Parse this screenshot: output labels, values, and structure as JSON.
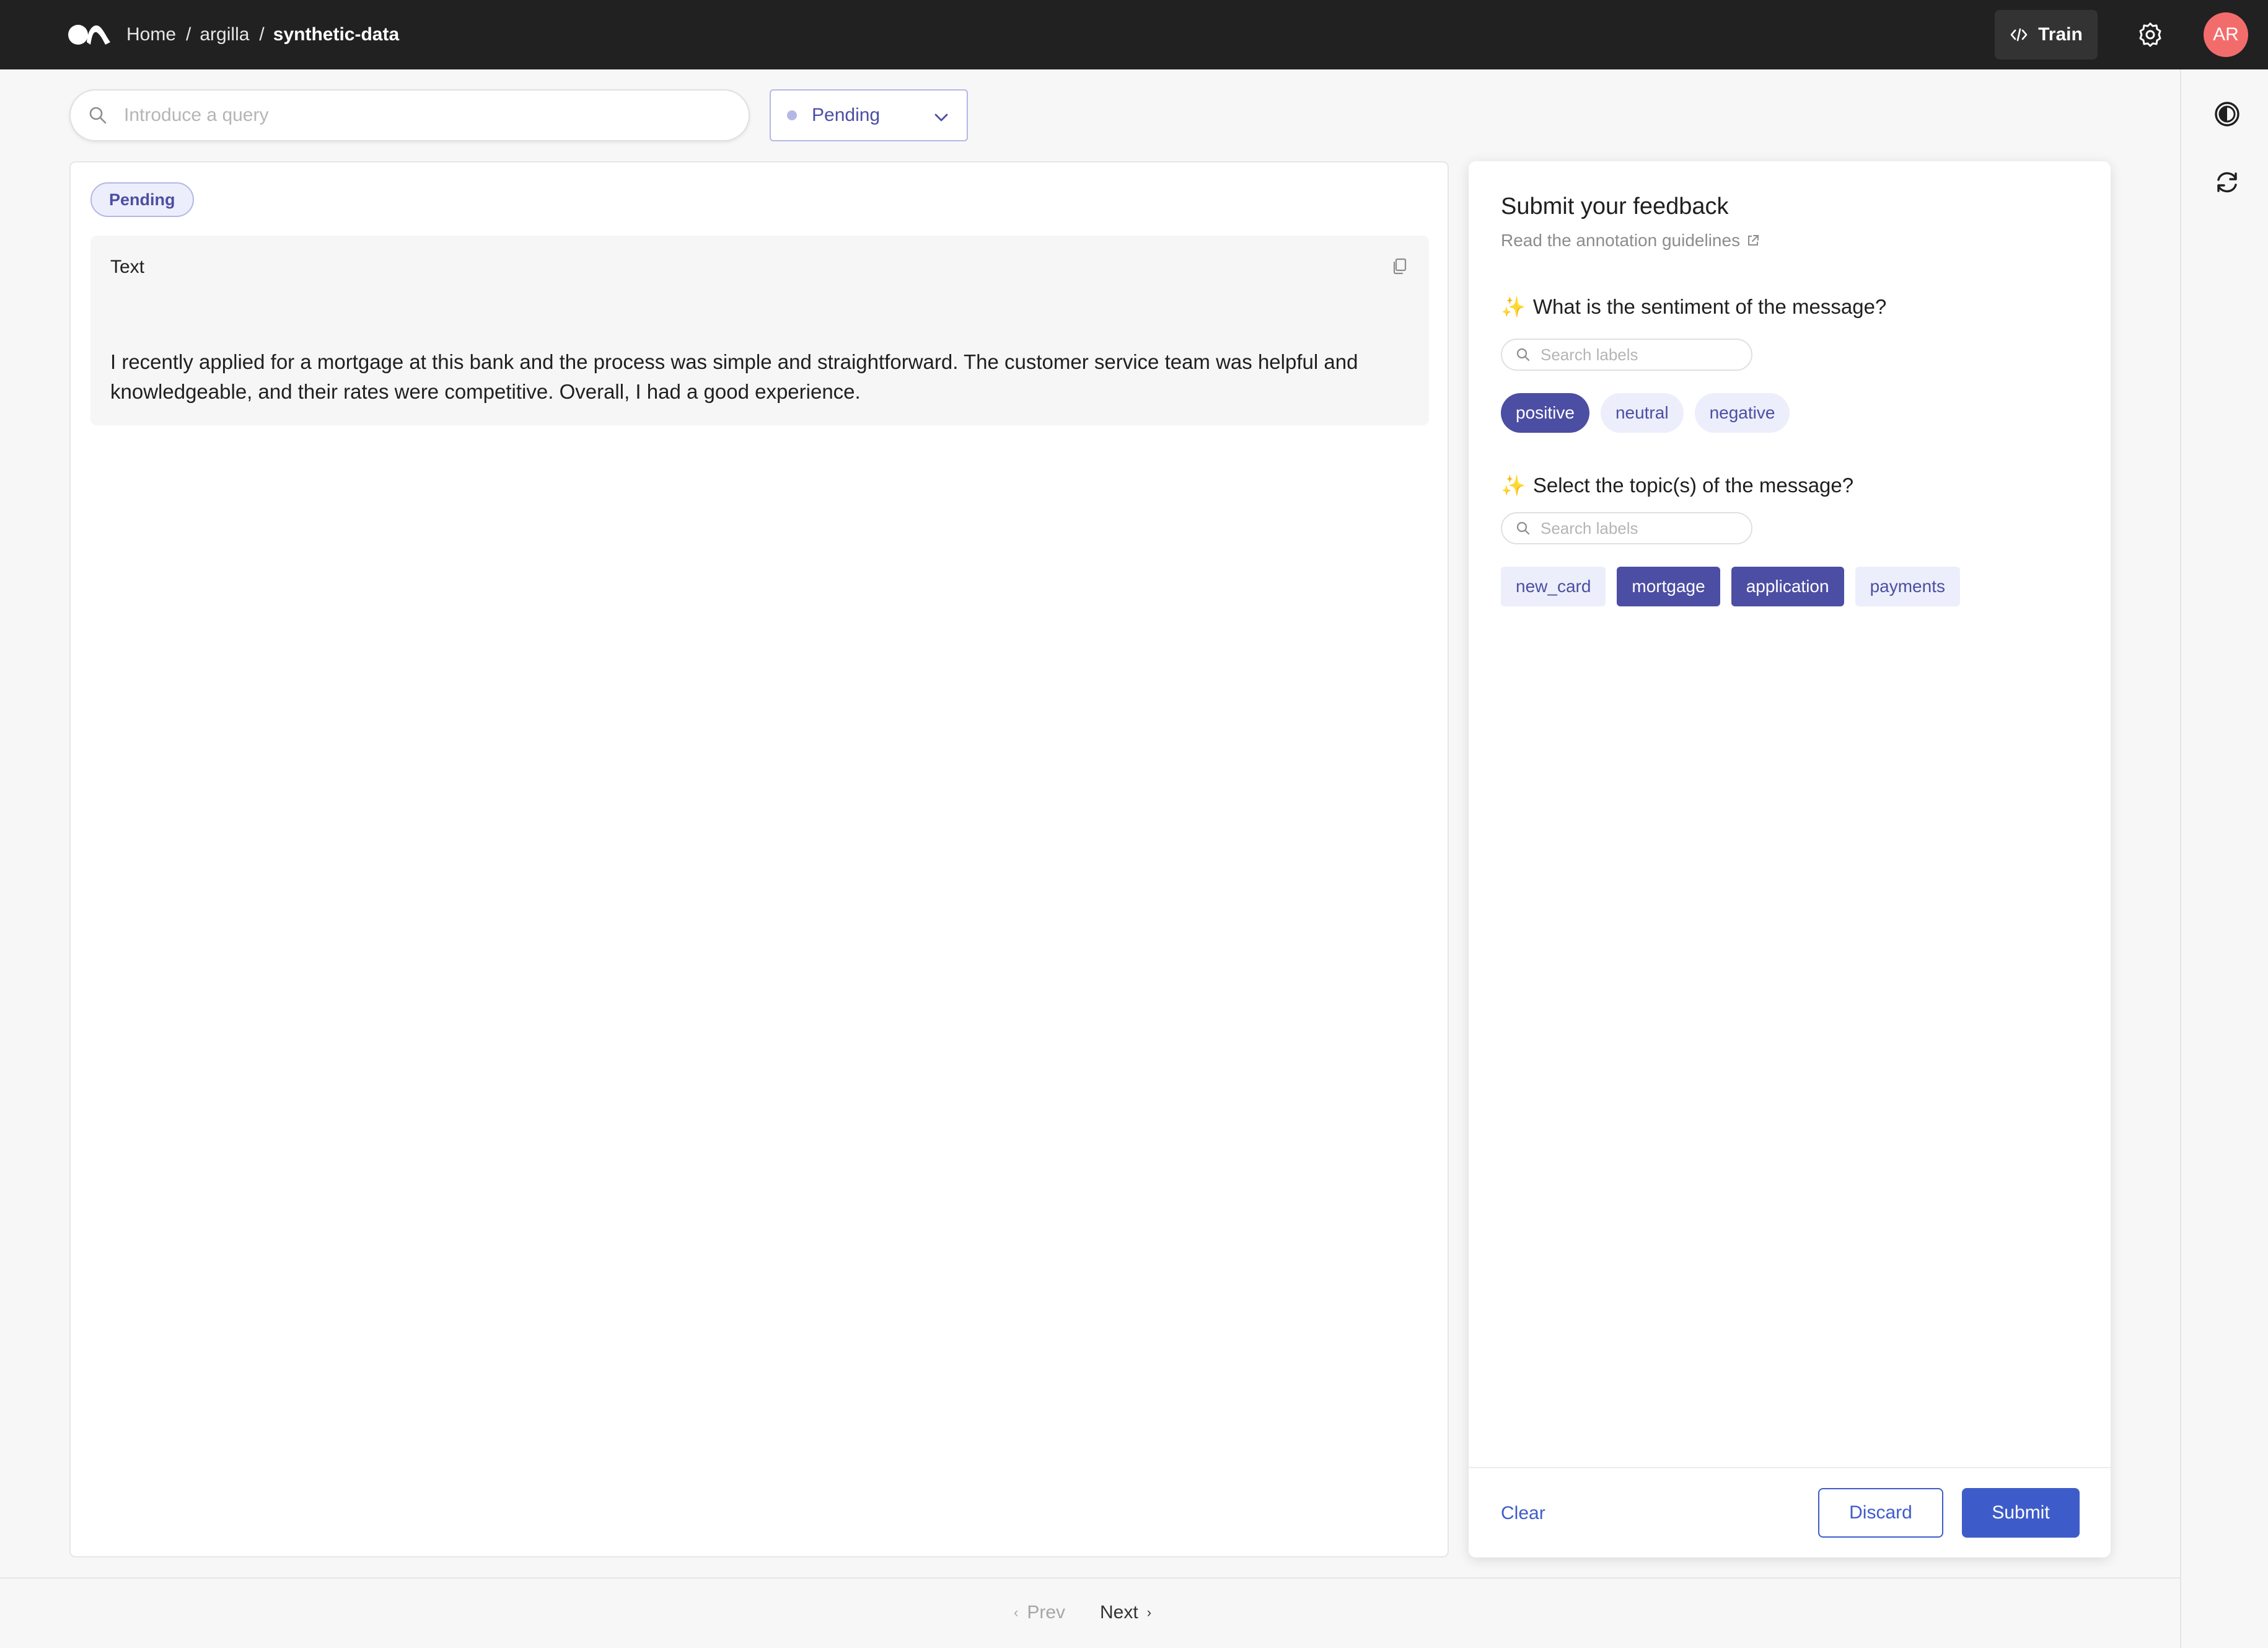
{
  "topbar": {
    "breadcrumb": [
      "Home",
      "argilla"
    ],
    "breadcrumb_separator": "/",
    "current": "synthetic-data",
    "train_label": "Train",
    "avatar_initials": "AR"
  },
  "search": {
    "placeholder": "Introduce a query",
    "value": ""
  },
  "status_filter": {
    "selected": "Pending"
  },
  "record": {
    "status_badge": "Pending",
    "field_title": "Text",
    "field_text": "I recently applied for a mortgage at this bank and the process was simple and straightforward. The customer service team was helpful and knowledgeable, and their rates were competitive. Overall, I had a good experience."
  },
  "feedback": {
    "title": "Submit your feedback",
    "guidelines_link": "Read the annotation guidelines",
    "questions": [
      {
        "icon": "✨",
        "text": "What is the sentiment of the message?",
        "search_placeholder": "Search labels",
        "labels": [
          {
            "label": "positive",
            "selected": true
          },
          {
            "label": "neutral",
            "selected": false
          },
          {
            "label": "negative",
            "selected": false
          }
        ]
      },
      {
        "icon": "✨",
        "text": "Select the topic(s) of the message?",
        "search_placeholder": "Search labels",
        "labels": [
          {
            "label": "new_card",
            "selected": false
          },
          {
            "label": "mortgage",
            "selected": true
          },
          {
            "label": "application",
            "selected": true
          },
          {
            "label": "payments",
            "selected": false
          }
        ]
      }
    ],
    "clear_label": "Clear",
    "discard_label": "Discard",
    "submit_label": "Submit"
  },
  "pagination": {
    "prev_label": "Prev",
    "next_label": "Next"
  },
  "colors": {
    "topbar_bg": "#212121",
    "accent": "#4c4ea3",
    "primary_button": "#3e5cc9",
    "chip_bg": "#eceefb",
    "avatar_bg": "#f36c6c"
  },
  "icons": [
    "argilla-logo-icon",
    "code-icon",
    "gear-icon",
    "theme-contrast-icon",
    "refresh-icon",
    "search-icon",
    "chevron-down-icon",
    "copy-icon",
    "external-link-icon",
    "chevron-left-icon",
    "chevron-right-icon"
  ]
}
